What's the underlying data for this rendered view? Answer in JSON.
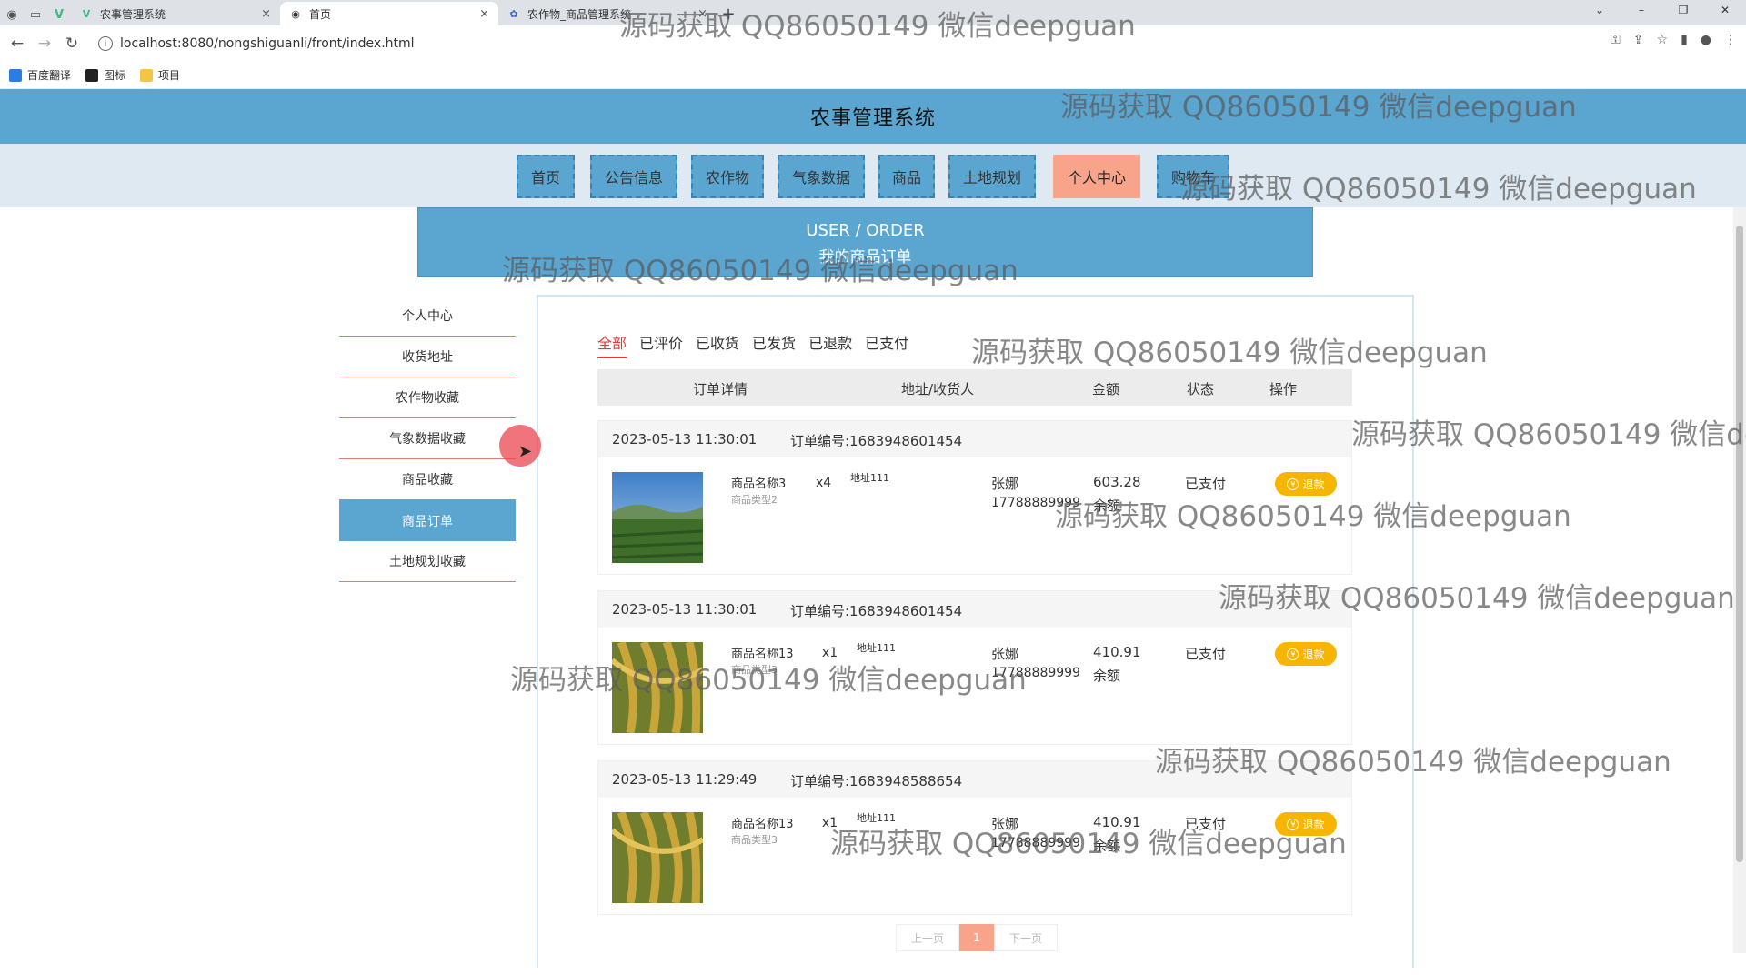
{
  "browser": {
    "tabs": [
      {
        "title": "农事管理系统",
        "close": "×"
      },
      {
        "title": "首页",
        "close": "×"
      },
      {
        "title": "农作物_商品管理系统",
        "close": "×"
      }
    ],
    "new_tab": "+",
    "url": "localhost:8080/nongshiguanli/front/index.html",
    "bookmarks": [
      "百度翻译",
      "图标",
      "项目"
    ],
    "window_controls": [
      "⌄",
      "–",
      "❐",
      "✕"
    ]
  },
  "site": {
    "title": "农事管理系统",
    "nav": [
      "首页",
      "公告信息",
      "农作物",
      "气象数据",
      "商品",
      "土地规划",
      "个人中心",
      "购物车"
    ],
    "banner": {
      "en": "USER / ORDER",
      "cn": "我的商品订单"
    }
  },
  "sidebar": {
    "items": [
      "个人中心",
      "收货地址",
      "农作物收藏",
      "气象数据收藏",
      "商品收藏",
      "商品订单",
      "土地规划收藏"
    ]
  },
  "filters": [
    "全部",
    "已评价",
    "已收货",
    "已发货",
    "已退款",
    "已支付"
  ],
  "table_headers": [
    "订单详情",
    "地址/收货人",
    "金额",
    "状态",
    "操作"
  ],
  "orders": [
    {
      "date": "2023-05-13 11:30:01",
      "order_no": "订单编号:1683948601454",
      "product": "商品名称3",
      "type": "商品类型2",
      "qty": "x4",
      "address": "地址111",
      "receiver": "张娜",
      "phone": "17788889999",
      "amount": "603.28",
      "pay": "余额",
      "status": "已支付",
      "action": "退款"
    },
    {
      "date": "2023-05-13 11:30:01",
      "order_no": "订单编号:1683948601454",
      "product": "商品名称13",
      "type": "商品类型3",
      "qty": "x1",
      "address": "地址111",
      "receiver": "张娜",
      "phone": "17788889999",
      "amount": "410.91",
      "pay": "余额",
      "status": "已支付",
      "action": "退款"
    },
    {
      "date": "2023-05-13 11:29:49",
      "order_no": "订单编号:1683948588654",
      "product": "商品名称13",
      "type": "商品类型3",
      "qty": "x1",
      "address": "地址111",
      "receiver": "张娜",
      "phone": "17788889999",
      "amount": "410.91",
      "pay": "余额",
      "status": "已支付",
      "action": "退款"
    }
  ],
  "pager": {
    "prev": "上一页",
    "current": "1",
    "next": "下一页"
  },
  "watermark": "源码获取 QQ86050149 微信deepguan",
  "colors": {
    "primary": "#5ba6d1",
    "active": "#f8a48a",
    "refund": "#f7b500",
    "filter_active": "#e33333"
  }
}
